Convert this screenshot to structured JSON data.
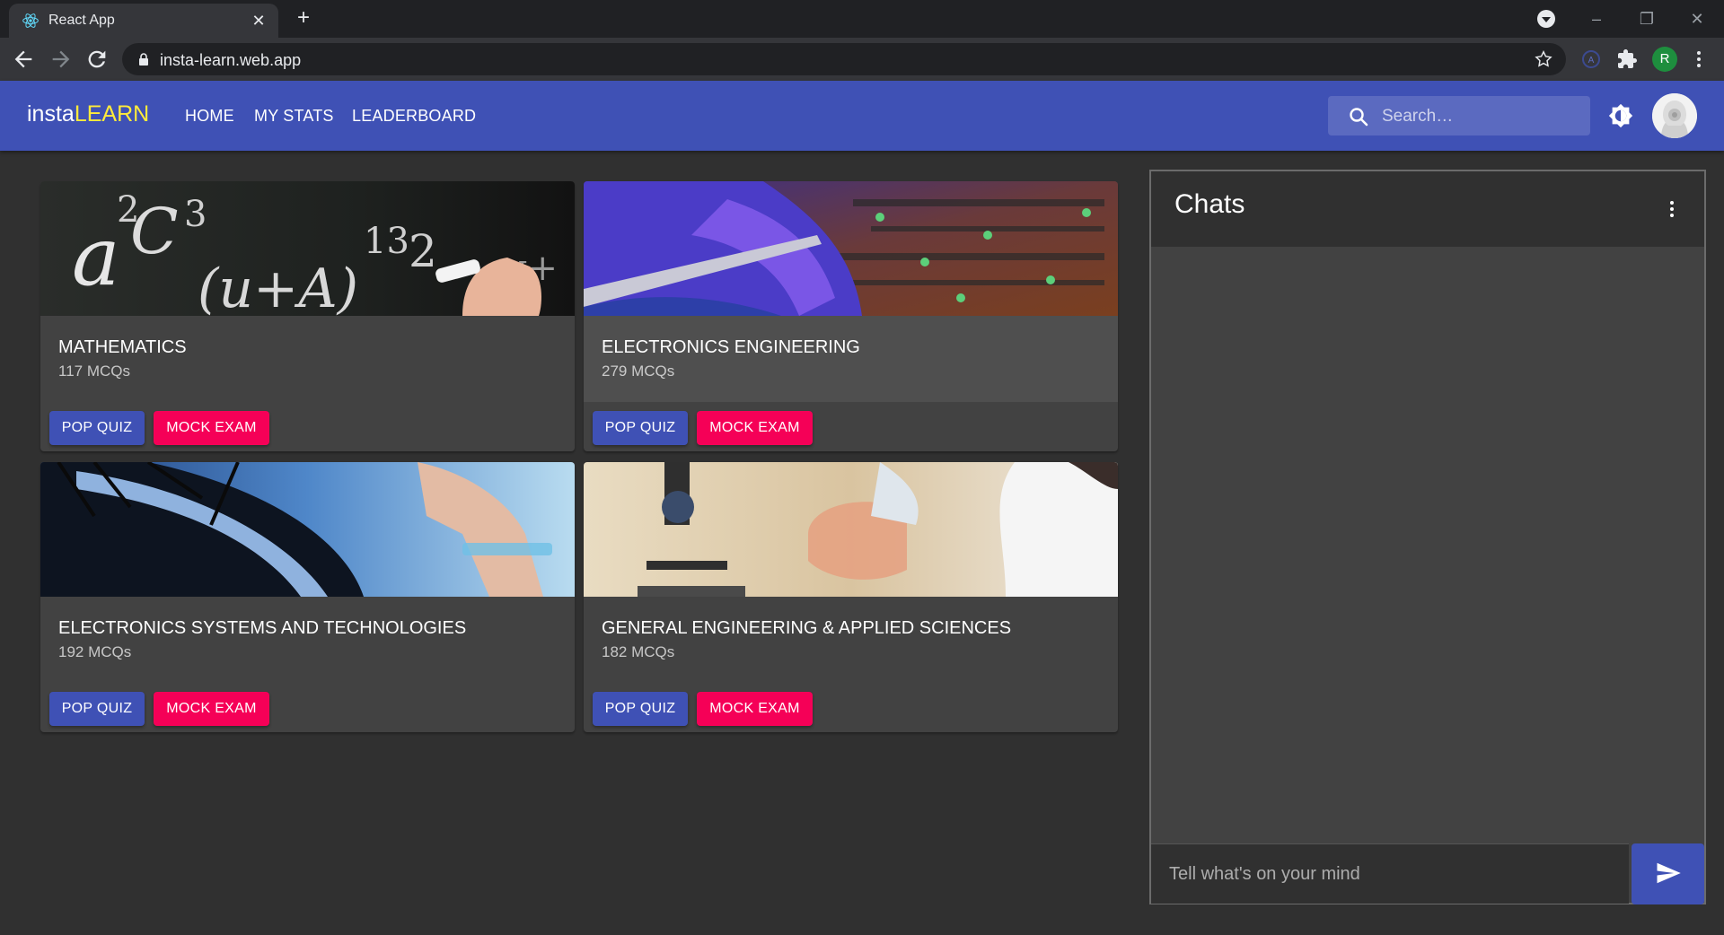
{
  "browser": {
    "tab_title": "React App",
    "url": "insta-learn.web.app",
    "profile_initial": "R"
  },
  "app": {
    "brand_prefix": "insta",
    "brand_accent": "LEARN",
    "nav": [
      "HOME",
      "MY STATS",
      "LEADERBOARD"
    ],
    "search_placeholder": "Search…"
  },
  "colors": {
    "primary": "#3f51b5",
    "secondary": "#f50057",
    "brand_accent": "#ffeb3b"
  },
  "cards": [
    {
      "title": "MATHEMATICS",
      "subtitle": "117 MCQs",
      "pop_label": "POP QUIZ",
      "mock_label": "MOCK EXAM"
    },
    {
      "title": "ELECTRONICS ENGINEERING",
      "subtitle": "279 MCQs",
      "pop_label": "POP QUIZ",
      "mock_label": "MOCK EXAM"
    },
    {
      "title": "ELECTRONICS SYSTEMS AND TECHNOLOGIES",
      "subtitle": "192 MCQs",
      "pop_label": "POP QUIZ",
      "mock_label": "MOCK EXAM"
    },
    {
      "title": "GENERAL ENGINEERING & APPLIED SCIENCES",
      "subtitle": "182 MCQs",
      "pop_label": "POP QUIZ",
      "mock_label": "MOCK EXAM"
    }
  ],
  "chats": {
    "title": "Chats",
    "input_placeholder": "Tell what's on your mind"
  }
}
